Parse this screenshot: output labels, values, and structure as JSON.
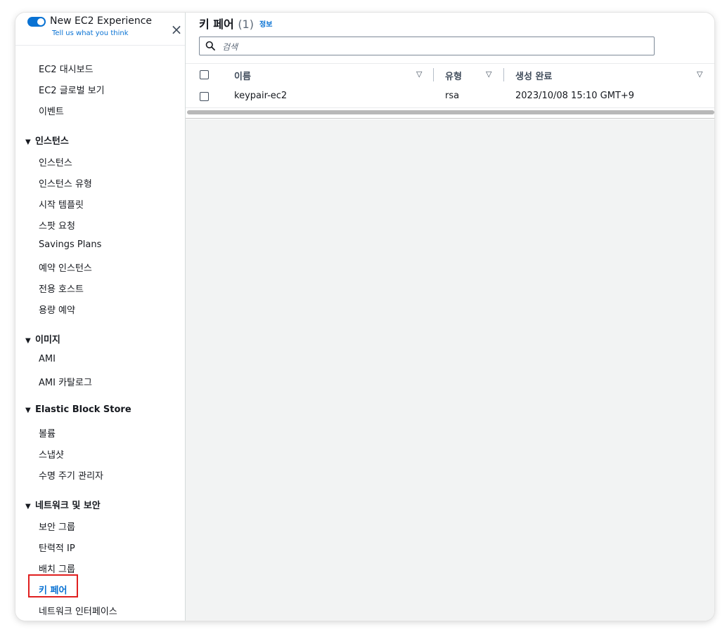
{
  "experience": {
    "title": "New EC2 Experience",
    "subtitle": "Tell us what you think",
    "toggle_on": true
  },
  "close_symbol": "×",
  "nav": {
    "top_items": [
      "EC2 대시보드",
      "EC2 글로벌 보기",
      "이벤트"
    ],
    "sections": [
      {
        "title": "인스턴스",
        "items": [
          "인스턴스",
          "인스턴스 유형",
          "시작 템플릿",
          "스팟 요청",
          "Savings Plans",
          "예약 인스턴스",
          "전용 호스트",
          "용량 예약"
        ]
      },
      {
        "title": "이미지",
        "items": [
          "AMI",
          "AMI 카탈로그"
        ]
      },
      {
        "title": "Elastic Block Store",
        "items": [
          "볼륨",
          "스냅샷",
          "수명 주기 관리자"
        ]
      },
      {
        "title": "네트워크 및 보안",
        "items": [
          "보안 그룹",
          "탄력적 IP",
          "배치 그룹",
          "키 페어",
          "네트워크 인터페이스"
        ]
      }
    ],
    "active_item": "키 페어"
  },
  "main": {
    "title": "키 페어",
    "count": "(1)",
    "info_link": "정보",
    "search_placeholder": "검색",
    "columns": [
      "이름",
      "유형",
      "생성 완료"
    ],
    "rows": [
      {
        "name": "keypair-ec2",
        "type": "rsa",
        "created": "2023/10/08 15:10 GMT+9"
      }
    ]
  },
  "colors": {
    "accent": "#0972d3",
    "highlight_border": "#e01f1f",
    "content_bg": "#f2f3f3"
  },
  "icons": [
    "toggle-icon",
    "close-icon",
    "caret-down-icon",
    "search-icon",
    "sort-icon"
  ]
}
